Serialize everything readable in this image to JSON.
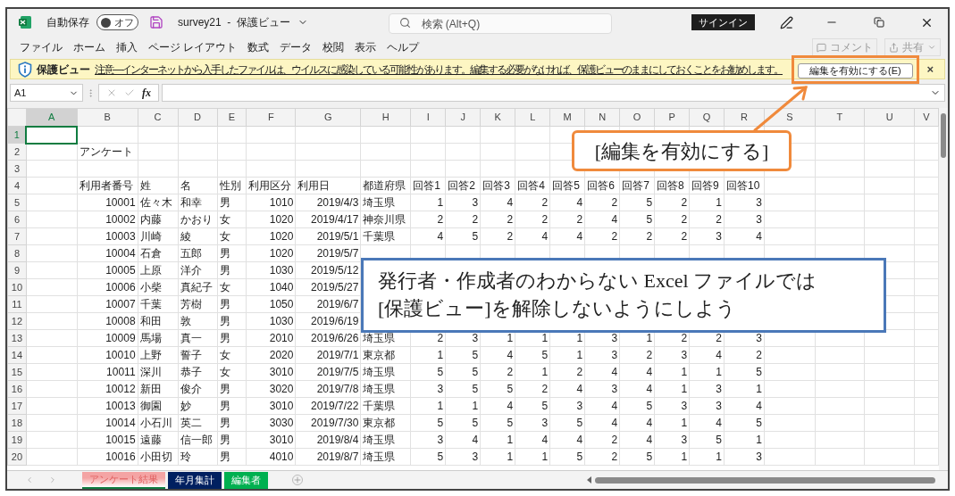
{
  "title_bar": {
    "autosave": {
      "label": "自動保存",
      "on": false,
      "state_text": "オフ"
    },
    "document_title": "survey21  -  保護ビュー",
    "search": {
      "placeholder": "検索 (Alt+Q)"
    },
    "sign_in": "サインイン"
  },
  "menu": {
    "items": [
      "ファイル",
      "ホーム",
      "挿入",
      "ページ レイアウト",
      "数式",
      "データ",
      "校閲",
      "表示",
      "ヘルプ"
    ],
    "actions": [
      {
        "label": "コメント",
        "disabled": true
      },
      {
        "label": "共有",
        "disabled": true
      }
    ]
  },
  "protected_view": {
    "label": "保護ビュー",
    "message": "注意—インターネットから入手したファイルは、ウイルスに感染している可能性があります。編集する必要がなければ、保護ビューのままにしておくことをお勧めします。",
    "button": "編集を有効にする(E)",
    "close": "×"
  },
  "formula_bar": {
    "name_box": "A1",
    "function_label": "fx"
  },
  "sheet": {
    "columns": [
      {
        "label": "A",
        "selected": true
      },
      {
        "label": "B",
        "selected": false
      },
      {
        "label": "C",
        "selected": false
      },
      {
        "label": "D",
        "selected": false
      },
      {
        "label": "E",
        "selected": false
      },
      {
        "label": "F",
        "selected": false
      },
      {
        "label": "G",
        "selected": false
      },
      {
        "label": "H",
        "selected": false
      },
      {
        "label": "I",
        "selected": false
      },
      {
        "label": "J",
        "selected": false
      },
      {
        "label": "K",
        "selected": false
      },
      {
        "label": "L",
        "selected": false
      },
      {
        "label": "M",
        "selected": false
      },
      {
        "label": "N",
        "selected": false
      },
      {
        "label": "O",
        "selected": false
      },
      {
        "label": "P",
        "selected": false
      },
      {
        "label": "Q",
        "selected": false
      },
      {
        "label": "R",
        "selected": false
      },
      {
        "label": "S",
        "selected": false
      },
      {
        "label": "T",
        "selected": false
      },
      {
        "label": "U",
        "selected": false
      },
      {
        "label": "V",
        "selected": false
      }
    ],
    "rows": [
      {
        "number": "1",
        "selected": true,
        "cells": []
      },
      {
        "number": "2",
        "selected": false,
        "cells": [
          null,
          "アンケート"
        ]
      },
      {
        "number": "3",
        "selected": false,
        "cells": []
      },
      {
        "number": "4",
        "selected": false,
        "cells": [
          null,
          "利用者番号",
          "姓",
          "名",
          "性別",
          "利用区分",
          "利用日",
          "都道府県",
          "回答1",
          "回答2",
          "回答3",
          "回答4",
          "回答5",
          "回答6",
          "回答7",
          "回答8",
          "回答9",
          "回答10"
        ]
      },
      {
        "number": "5",
        "selected": false,
        "cells": [
          null,
          "10001",
          "佐々木",
          "和幸",
          "男",
          "1010",
          "2019/4/3",
          "埼玉県",
          "1",
          "3",
          "4",
          "2",
          "4",
          "2",
          "5",
          "2",
          "1",
          "3"
        ]
      },
      {
        "number": "6",
        "selected": false,
        "cells": [
          null,
          "10002",
          "内藤",
          "かおり",
          "女",
          "1020",
          "2019/4/17",
          "神奈川県",
          "2",
          "2",
          "2",
          "2",
          "2",
          "4",
          "5",
          "2",
          "2",
          "3"
        ]
      },
      {
        "number": "7",
        "selected": false,
        "cells": [
          null,
          "10003",
          "川崎",
          "綾",
          "女",
          "1020",
          "2019/5/1",
          "千葉県",
          "4",
          "5",
          "2",
          "4",
          "4",
          "2",
          "2",
          "2",
          "3",
          "4"
        ]
      },
      {
        "number": "8",
        "selected": false,
        "cells": [
          null,
          "10004",
          "石倉",
          "五郎",
          "男",
          "1020",
          "2019/5/7"
        ]
      },
      {
        "number": "9",
        "selected": false,
        "cells": [
          null,
          "10005",
          "上原",
          "洋介",
          "男",
          "1030",
          "2019/5/12"
        ]
      },
      {
        "number": "10",
        "selected": false,
        "cells": [
          null,
          "10006",
          "小柴",
          "真紀子",
          "女",
          "1040",
          "2019/5/27"
        ]
      },
      {
        "number": "11",
        "selected": false,
        "cells": [
          null,
          "10007",
          "千葉",
          "芳樹",
          "男",
          "1050",
          "2019/6/7"
        ]
      },
      {
        "number": "12",
        "selected": false,
        "cells": [
          null,
          "10008",
          "和田",
          "敦",
          "男",
          "1030",
          "2019/6/19"
        ]
      },
      {
        "number": "13",
        "selected": false,
        "cells": [
          null,
          "10009",
          "馬場",
          "真一",
          "男",
          "2010",
          "2019/6/26",
          "埼玉県",
          "2",
          "3",
          "1",
          "1",
          "1",
          "3",
          "1",
          "2",
          "2",
          "3"
        ]
      },
      {
        "number": "14",
        "selected": false,
        "cells": [
          null,
          "10010",
          "上野",
          "誓子",
          "女",
          "2020",
          "2019/7/1",
          "東京都",
          "1",
          "5",
          "4",
          "5",
          "1",
          "3",
          "2",
          "3",
          "4",
          "2"
        ]
      },
      {
        "number": "15",
        "selected": false,
        "cells": [
          null,
          "10011",
          "深川",
          "恭子",
          "女",
          "3010",
          "2019/7/5",
          "埼玉県",
          "5",
          "5",
          "2",
          "1",
          "2",
          "4",
          "4",
          "1",
          "1",
          "5"
        ]
      },
      {
        "number": "16",
        "selected": false,
        "cells": [
          null,
          "10012",
          "新田",
          "俊介",
          "男",
          "3020",
          "2019/7/8",
          "埼玉県",
          "3",
          "5",
          "5",
          "2",
          "4",
          "3",
          "4",
          "1",
          "3",
          "1"
        ]
      },
      {
        "number": "17",
        "selected": false,
        "cells": [
          null,
          "10013",
          "御園",
          "妙",
          "男",
          "3010",
          "2019/7/22",
          "千葉県",
          "1",
          "1",
          "4",
          "5",
          "3",
          "4",
          "5",
          "3",
          "3",
          "4"
        ]
      },
      {
        "number": "18",
        "selected": false,
        "cells": [
          null,
          "10014",
          "小石川",
          "英二",
          "男",
          "3030",
          "2019/7/30",
          "東京都",
          "5",
          "5",
          "5",
          "3",
          "5",
          "4",
          "4",
          "1",
          "4",
          "5"
        ]
      },
      {
        "number": "19",
        "selected": false,
        "cells": [
          null,
          "10015",
          "遠藤",
          "信一郎",
          "男",
          "3010",
          "2019/8/4",
          "埼玉県",
          "3",
          "4",
          "1",
          "4",
          "4",
          "2",
          "4",
          "3",
          "5",
          "1"
        ]
      },
      {
        "number": "20",
        "selected": false,
        "cells": [
          null,
          "10016",
          "小田切",
          "玲",
          "男",
          "4010",
          "2019/8/7",
          "埼玉県",
          "5",
          "3",
          "1",
          "1",
          "5",
          "2",
          "5",
          "1",
          "1",
          "3"
        ]
      }
    ]
  },
  "sheet_tabs": [
    {
      "label": "アンケート結果",
      "selected": true,
      "color": "#f4a4a4"
    },
    {
      "label": "年月集計",
      "selected": false,
      "color": "#002060"
    },
    {
      "label": "編集者",
      "selected": false,
      "color": "#00b050"
    }
  ],
  "callouts": [
    {
      "kind": "label",
      "text": "[編集を有効にする]",
      "color": "#f08a3c"
    },
    {
      "kind": "note",
      "text": "発行者・作成者のわからない Excel ファイルでは\n[保護ビュー]を解除しないようにしよう",
      "color": "#4a78b8"
    }
  ]
}
